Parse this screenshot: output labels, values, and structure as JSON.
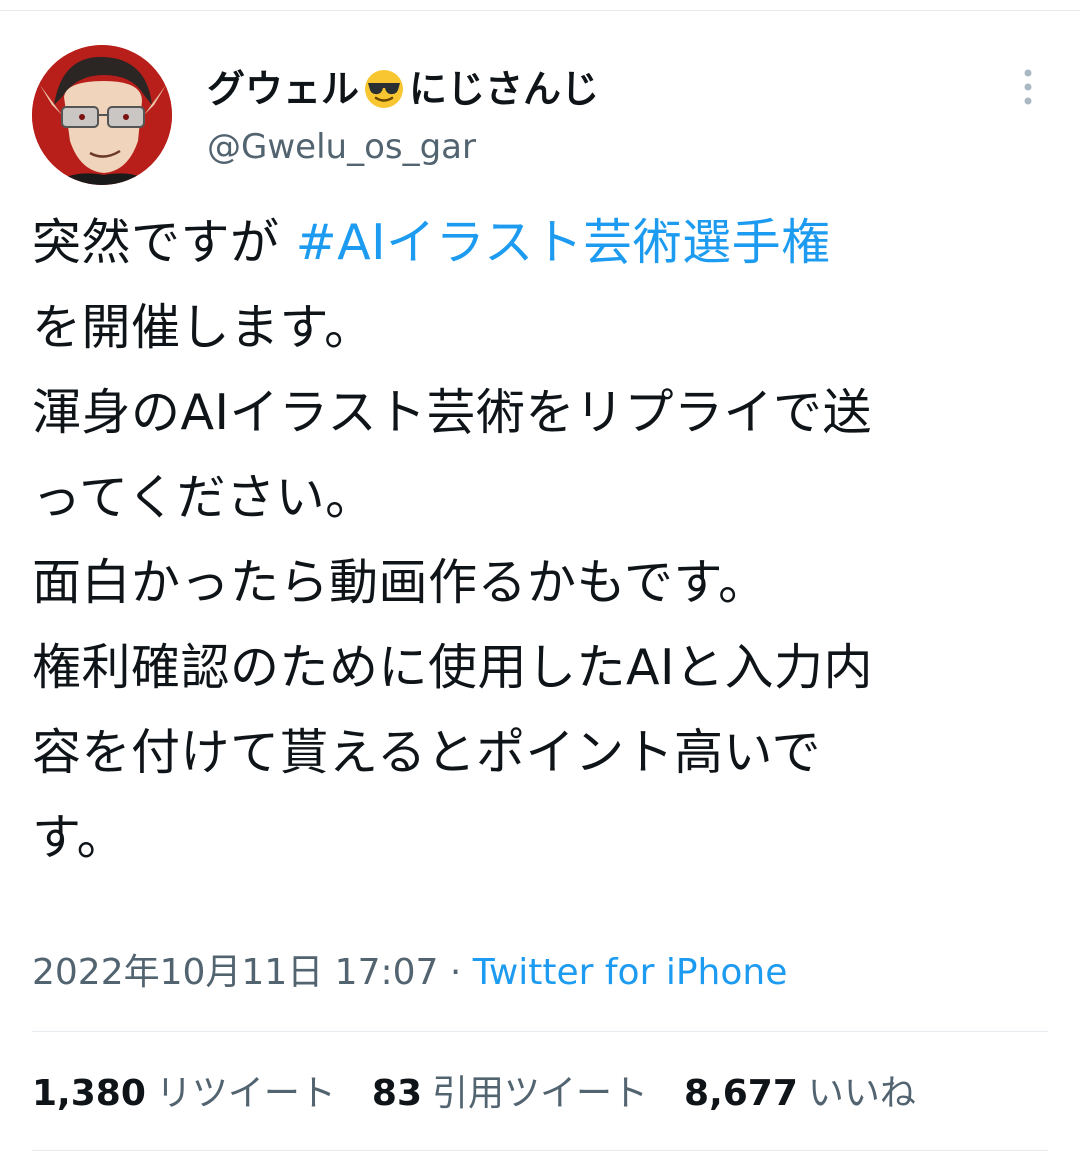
{
  "author": {
    "display_name_prefix": "グウェル",
    "display_name_emoji": "smiling-face-with-sunglasses-icon",
    "display_name_suffix": "にじさんじ",
    "handle": "@Gwelu_os_gar",
    "avatar_icon": "avatar-icon"
  },
  "tweet": {
    "line1_text": "突然ですが ",
    "line1_hashtag": "#AIイラスト芸術選手権",
    "line2": "を開催します。",
    "line3": "渾身のAIイラスト芸術をリプライで送",
    "line4": "ってください。",
    "line5": "面白かったら動画作るかもです。",
    "line6": "権利確認のために使用したAIと入力内",
    "line7": "容を付けて貰えるとポイント高いで",
    "line8": "す。"
  },
  "meta": {
    "timestamp": "2022年10月11日 17:07",
    "separator": " · ",
    "source": "Twitter for iPhone"
  },
  "stats": {
    "retweets_count": "1,380",
    "retweets_label": "リツイート",
    "quotes_count": "83",
    "quotes_label": "引用ツイート",
    "likes_count": "8,677",
    "likes_label": "いいね"
  },
  "colors": {
    "link": "#1d9bf0",
    "secondary_text": "#536471",
    "primary_text": "#0f1419",
    "divider": "#e6ecf0",
    "avatar_bg": "#b91f1a"
  }
}
